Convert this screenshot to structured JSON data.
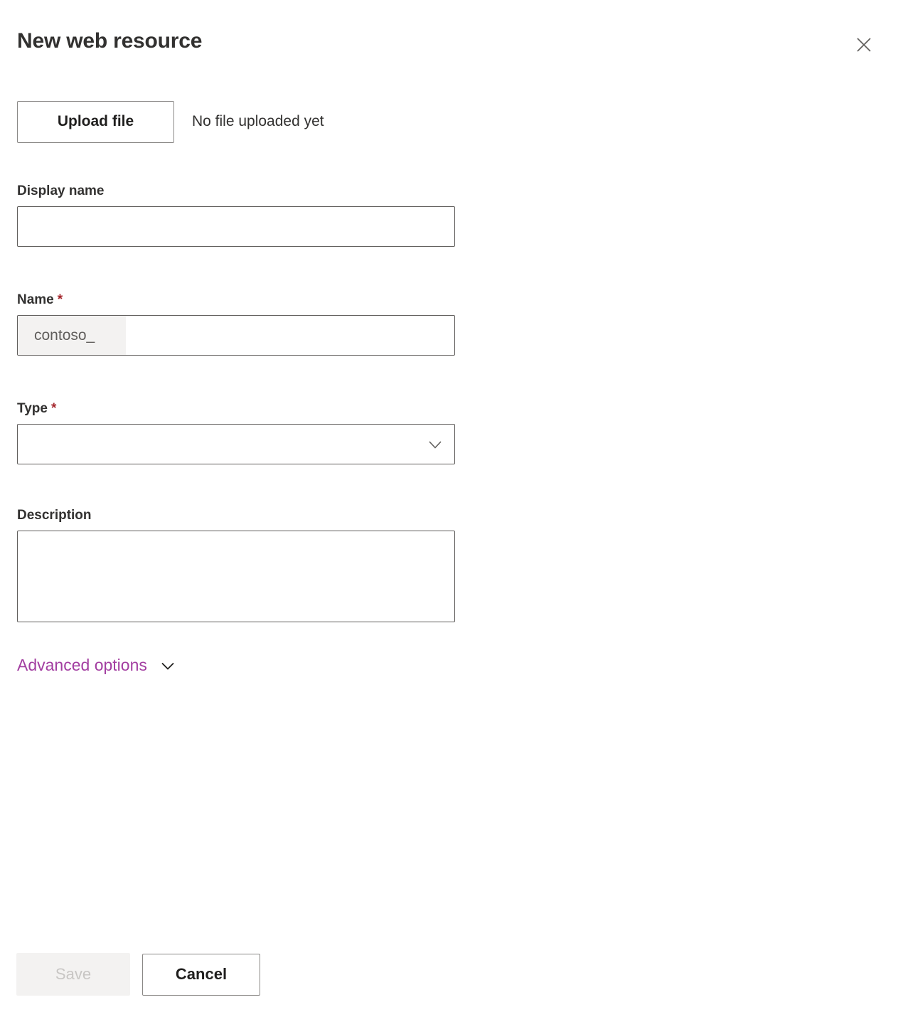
{
  "header": {
    "title": "New web resource",
    "close_icon": "close-icon"
  },
  "upload": {
    "button_label": "Upload file",
    "status_text": "No file uploaded yet"
  },
  "fields": {
    "display_name": {
      "label": "Display name",
      "value": "",
      "placeholder": ""
    },
    "name": {
      "label": "Name",
      "required_marker": "*",
      "prefix": "contoso_",
      "value": "",
      "placeholder": ""
    },
    "type": {
      "label": "Type",
      "required_marker": "*",
      "selected": "",
      "caret_icon": "chevron-down-icon"
    },
    "description": {
      "label": "Description",
      "value": "",
      "placeholder": ""
    }
  },
  "advanced": {
    "label": "Advanced options",
    "caret_icon": "chevron-down-icon"
  },
  "footer": {
    "save_label": "Save",
    "cancel_label": "Cancel"
  },
  "colors": {
    "accent_link": "#a33ea1",
    "required": "#a4262c",
    "text_primary": "#323130",
    "border": "#605e5c",
    "button_border": "#8a8886",
    "disabled_bg": "#f3f2f1",
    "disabled_text": "#c8c6c4"
  }
}
